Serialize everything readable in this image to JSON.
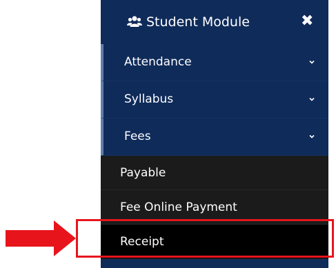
{
  "sidebar": {
    "header": {
      "icon": "users-group-icon",
      "title": "Student Module",
      "close_icon": "close-icon",
      "close_glyph": "✖"
    },
    "items": [
      {
        "label": "Attendance",
        "icon": "chevron-down-icon"
      },
      {
        "label": "Syllabus",
        "icon": "chevron-down-icon"
      },
      {
        "label": "Fees",
        "icon": "chevron-down-icon",
        "expanded": true
      }
    ],
    "fees_submenu": [
      {
        "label": "Payable"
      },
      {
        "label": "Fee Online Payment"
      },
      {
        "label": "Receipt",
        "highlighted": true
      }
    ]
  },
  "annotation": {
    "arrow_color": "#e8141c",
    "box_color": "#e8141c",
    "target": "Receipt"
  },
  "colors": {
    "sidebar_bg": "#0f2b5a",
    "submenu_bg": "#1b1b1c",
    "active_bg": "#000000",
    "text": "#ffffff"
  }
}
